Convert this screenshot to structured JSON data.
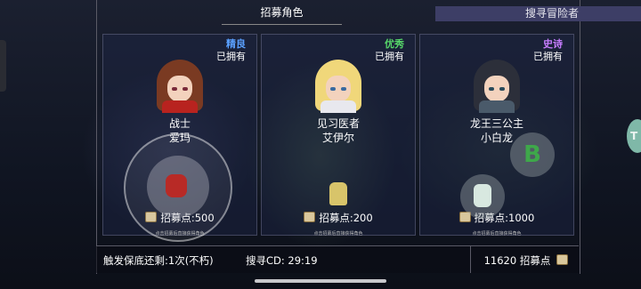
{
  "tabs": [
    {
      "label": "招募角色",
      "active": true
    },
    {
      "label": "搜寻冒险者",
      "active": false
    }
  ],
  "cards": [
    {
      "rarity": "精良",
      "rarity_color": "#5aa0ff",
      "owned": "已拥有",
      "class": "战士",
      "name": "爱玛",
      "cost": "招募点:500",
      "tip": "点击招募后直接获得角色"
    },
    {
      "rarity": "优秀",
      "rarity_color": "#57d86a",
      "owned": "已拥有",
      "class": "见习医者",
      "name": "艾伊尔",
      "cost": "招募点:200",
      "tip": "点击招募后直接获得角色"
    },
    {
      "rarity": "史诗",
      "rarity_color": "#c77dff",
      "owned": "已拥有",
      "class": "龙王三公主",
      "name": "小白龙",
      "cost": "招募点:1000",
      "tip": "点击招募后直接获得角色"
    }
  ],
  "buttons": {
    "b_button": "B",
    "side_button": "T"
  },
  "footer": {
    "guarantee": "触发保底还剩:1次(不朽)",
    "cooldown_label": "搜寻CD:",
    "cooldown_value": "29:19",
    "points": "11620 招募点"
  }
}
